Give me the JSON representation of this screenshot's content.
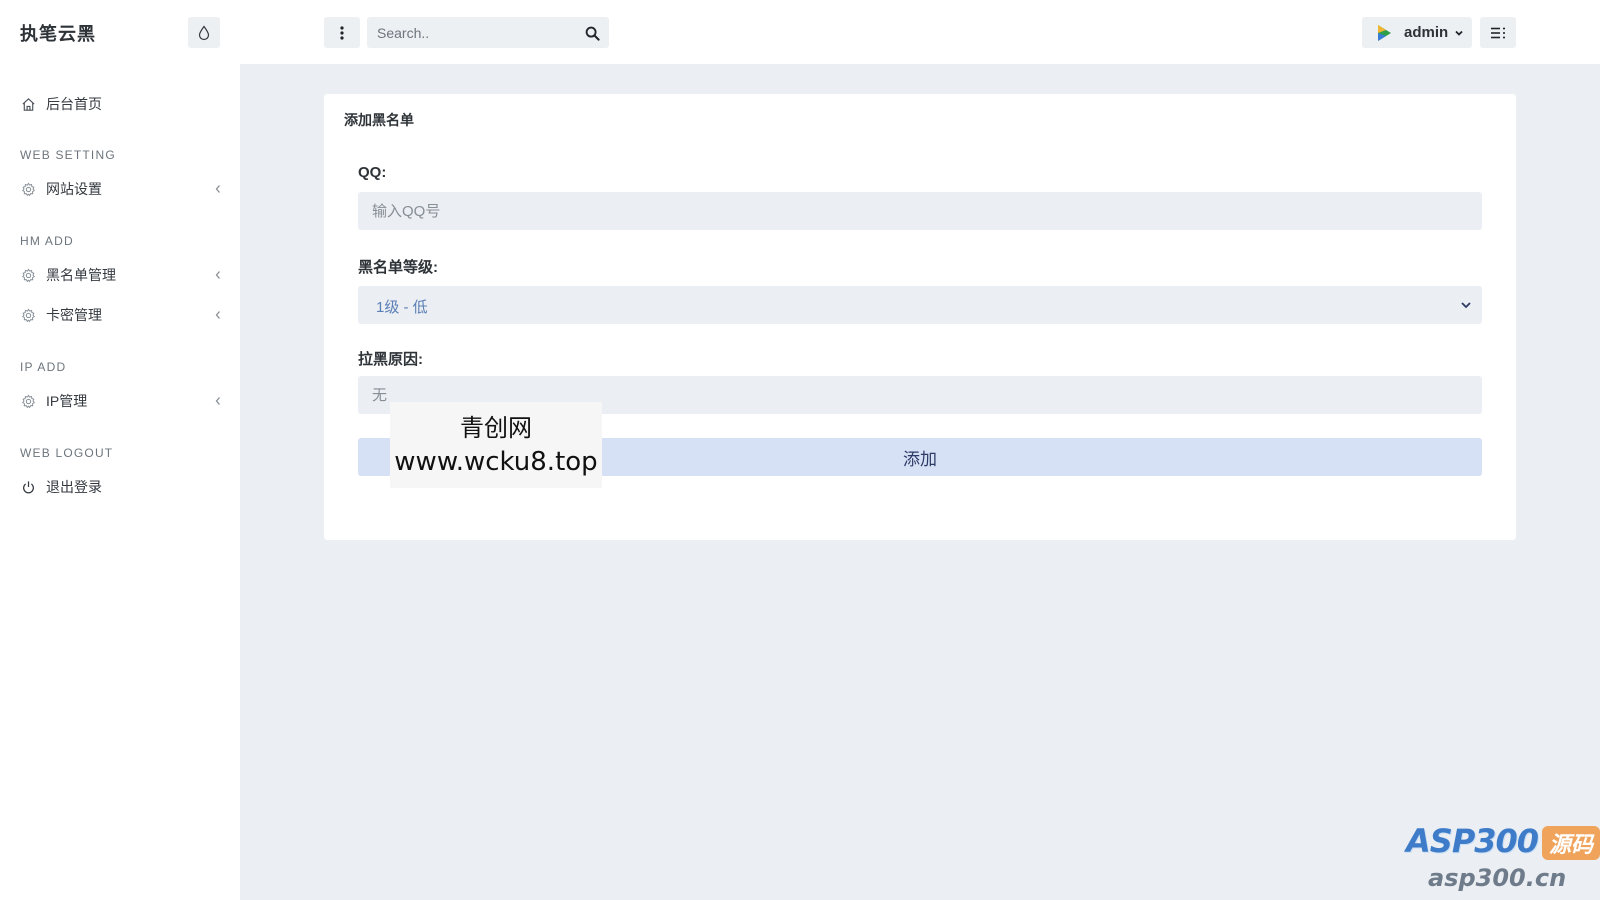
{
  "header": {
    "brand": "执笔云黑",
    "search_placeholder": "Search..",
    "user_name": "admin"
  },
  "sidebar": {
    "home_label": "后台首页",
    "sections": [
      {
        "heading": "WEB SETTING",
        "items": [
          {
            "label": "网站设置"
          }
        ]
      },
      {
        "heading": "HM ADD",
        "items": [
          {
            "label": "黑名单管理"
          },
          {
            "label": "卡密管理"
          }
        ]
      },
      {
        "heading": "IP ADD",
        "items": [
          {
            "label": "IP管理"
          }
        ]
      },
      {
        "heading": "WEB LOGOUT",
        "items": [
          {
            "label": "退出登录"
          }
        ]
      }
    ]
  },
  "form": {
    "title": "添加黑名单",
    "qq_label": "QQ:",
    "qq_placeholder": "输入QQ号",
    "level_label": "黑名单等级:",
    "level_selected": "1级 - 低",
    "reason_label": "拉黑原因:",
    "reason_placeholder": "无",
    "submit_label": "添加"
  },
  "overlay": {
    "watermark_line1": "青创网",
    "watermark_line2": "www.wcku8.top",
    "logo_brand": "ASP300",
    "logo_badge": "源码",
    "logo_domain": "asp300.cn"
  },
  "colors": {
    "accent": "#d6e1f5",
    "background": "#ebeef2",
    "select_text": "#5b7fb6"
  }
}
